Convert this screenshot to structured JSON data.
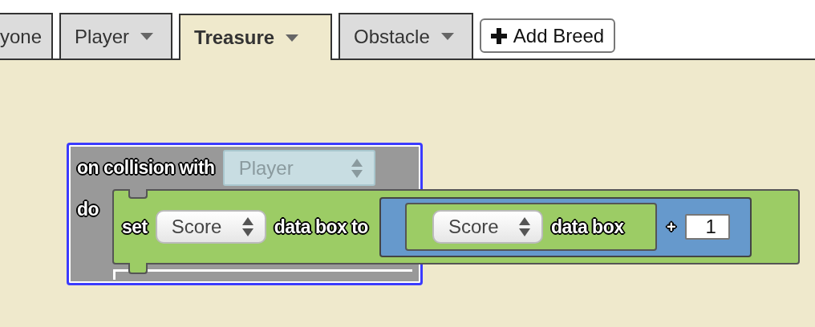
{
  "tabs": [
    {
      "label": "yone",
      "selected": false,
      "caret": false
    },
    {
      "label": "Player",
      "selected": false,
      "caret": true
    },
    {
      "label": "Treasure",
      "selected": true,
      "caret": true
    },
    {
      "label": "Obstacle",
      "selected": false,
      "caret": true
    }
  ],
  "add_button": {
    "label": "Add Breed"
  },
  "event_block": {
    "selected": true,
    "label": "on collision with",
    "dropdown": {
      "value": "Player",
      "disabled": true
    },
    "do_label": "do",
    "statement": {
      "label": "set",
      "dropdown": {
        "value": "Score",
        "disabled": false
      },
      "suffix": "data box to",
      "value": {
        "getter": {
          "dropdown": {
            "value": "Score",
            "disabled": false
          },
          "label": "data box"
        },
        "operator": "+",
        "operand": "1"
      }
    }
  }
}
